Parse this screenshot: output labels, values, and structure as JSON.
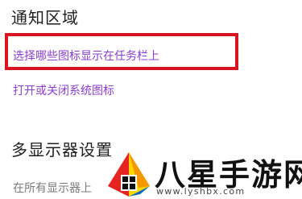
{
  "notification_area": {
    "title": "通知区域",
    "choose_icons_link": "选择哪些图标显示在任务栏上",
    "toggle_system_icons_link": "打开或关闭系统图标"
  },
  "multi_display": {
    "title": "多显示器设置",
    "show_on_all_displays_partial": "在所有显示器上"
  },
  "watermark": {
    "brand_text": "八星手游网",
    "url_text": "www.lyshbx.com",
    "colors": {
      "red": "#e52421",
      "orange": "#f39800",
      "yellow": "#ffd400",
      "green": "#3aa935",
      "blue": "#0068b7"
    }
  },
  "colors": {
    "link": "#8a3ec9",
    "highlight_border": "#d7141f"
  }
}
